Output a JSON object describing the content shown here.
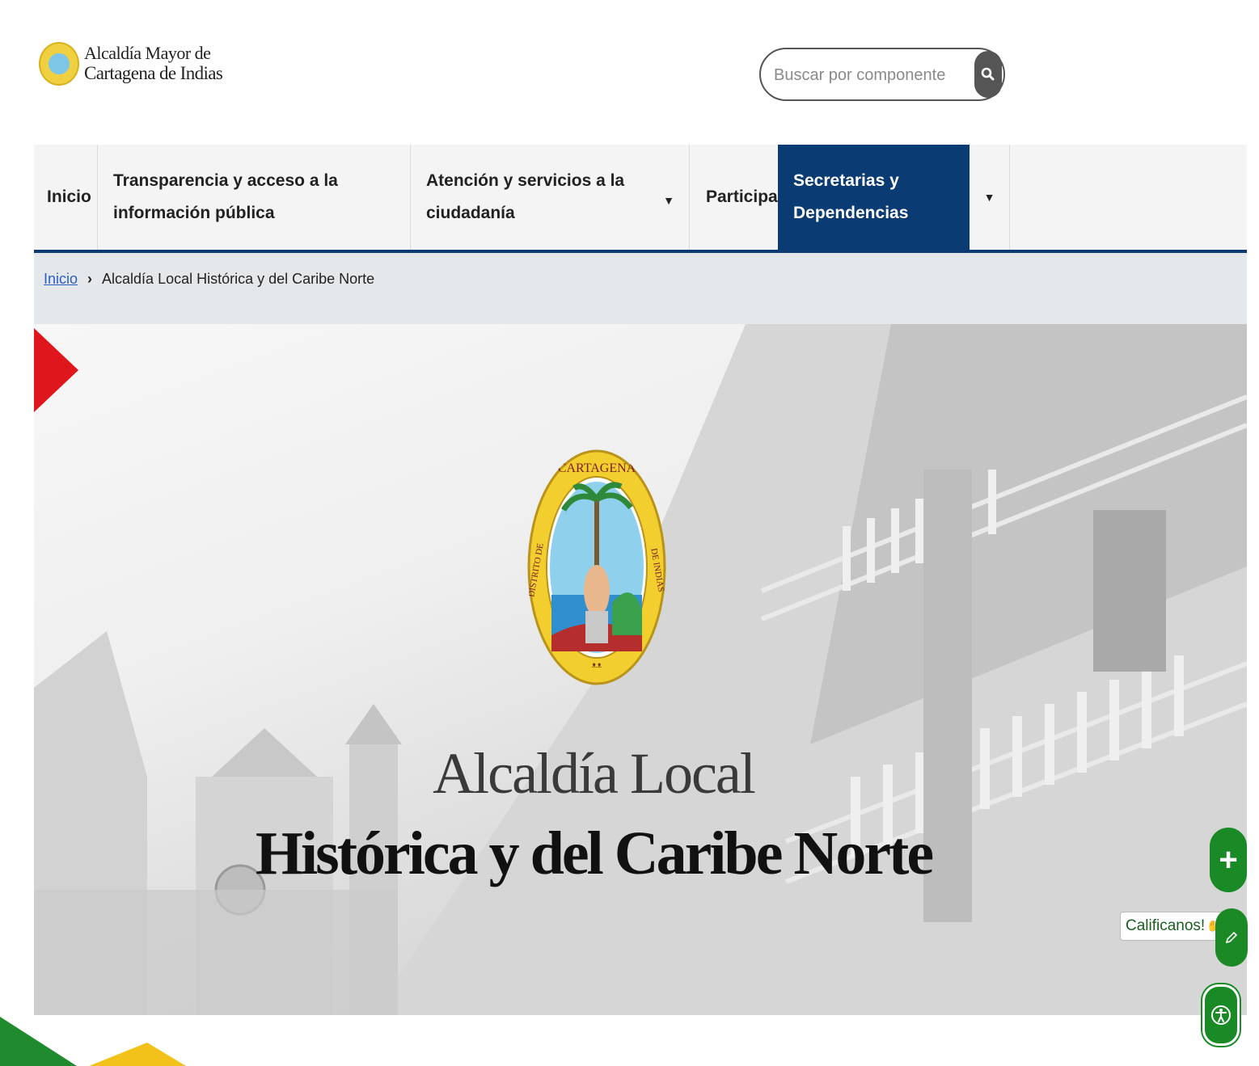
{
  "header": {
    "logo_line1": "Alcaldía Mayor de",
    "logo_line2": "Cartagena de Indias",
    "search_placeholder": "Buscar por componente"
  },
  "nav": {
    "items": [
      {
        "label": "Inicio"
      },
      {
        "label": "Transparencia y acceso a la información pública"
      },
      {
        "label": "Atención y servicios a la ciudadanía"
      },
      {
        "label": "Participa"
      },
      {
        "label": "Secretarias y Dependencias"
      }
    ],
    "active": "Secretarias y Dependencias",
    "active_color": "#0a3b73"
  },
  "breadcrumb": {
    "home": "Inicio",
    "current": "Alcaldía Local Histórica y del Caribe Norte"
  },
  "hero": {
    "title_line1": "Alcaldía Local",
    "title_line2": "Histórica y del Caribe Norte",
    "seal_text_top": "CARTAGENA",
    "seal_text_left": "DISTRITO DE",
    "seal_text_right": "DE INDIAS"
  },
  "floating": {
    "califica_label": "Calificanos!",
    "accent_color": "#1a8a26"
  }
}
